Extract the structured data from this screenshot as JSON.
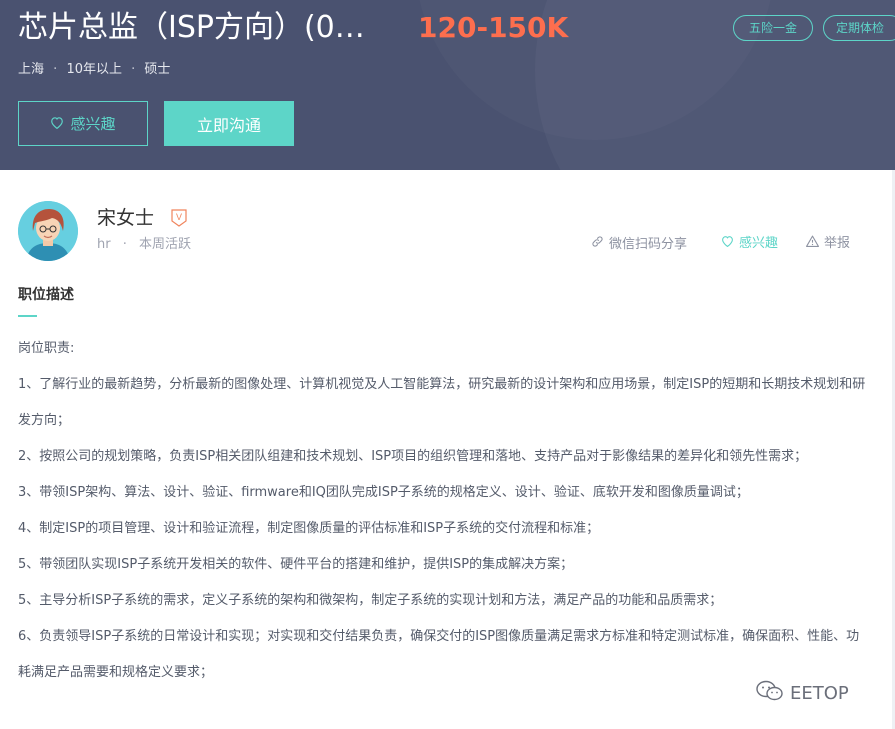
{
  "job": {
    "title": "芯片总监（ISP方向）(0…",
    "salary": "120-150K",
    "tags": [
      "五险一金",
      "定期体检"
    ],
    "location": "上海",
    "experience": "10年以上",
    "education": "硕士",
    "dot": "·"
  },
  "buttons": {
    "interest": "感兴趣",
    "chat": "立即沟通"
  },
  "recruiter": {
    "name": "宋女士",
    "badge": "V",
    "role": "hr",
    "sep": "·",
    "activity": "本周活跃"
  },
  "actions": {
    "share": "微信扫码分享",
    "interest": "感兴趣",
    "report": "举报"
  },
  "section": {
    "title": "职位描述"
  },
  "description": {
    "lines": [
      "岗位职责:",
      "1、了解行业的最新趋势，分析最新的图像处理、计算机视觉及人工智能算法，研究最新的设计架构和应用场景，制定ISP的短期和长期技术规划和研发方向；",
      "2、按照公司的规划策略，负责ISP相关团队组建和技术规划、ISP项目的组织管理和落地、支持产品对于影像结果的差异化和领先性需求；",
      "3、带领ISP架构、算法、设计、验证、firmware和IQ团队完成ISP子系统的规格定义、设计、验证、底软开发和图像质量调试；",
      "4、制定ISP的项目管理、设计和验证流程，制定图像质量的评估标准和ISP子系统的交付流程和标准；",
      "5、带领团队实现ISP子系统开发相关的软件、硬件平台的搭建和维护，提供ISP的集成解决方案；",
      "5、主导分析ISP子系统的需求，定义子系统的架构和微架构，制定子系统的实现计划和方法，满足产品的功能和品质需求；",
      "6、负责领导ISP子系统的日常设计和实现；对实现和交付结果负责，确保交付的ISP图像质量满足需求方标准和特定测试标准，确保面积、性能、功耗满足产品需要和规格定义要求；"
    ]
  },
  "watermark": {
    "text": "EETOP"
  },
  "colors": {
    "header_bg": "#4a5270",
    "accent": "#5dd5c8",
    "salary": "#fd6e4e",
    "badge": "#f0845c"
  },
  "icons": {
    "heart": "heart-icon",
    "link": "link-icon",
    "warning": "warning-icon",
    "wechat": "wechat-icon",
    "vip": "vip-badge-icon"
  }
}
